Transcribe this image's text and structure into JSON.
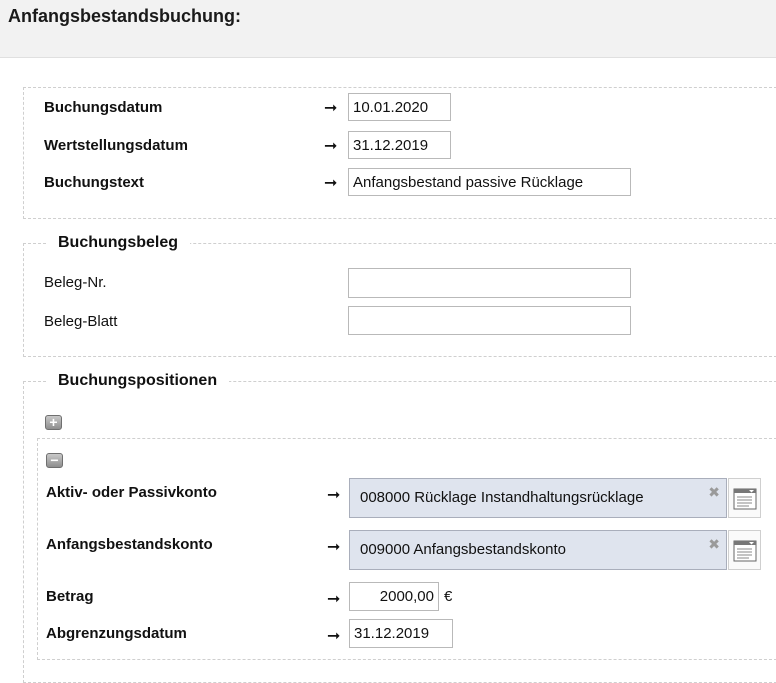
{
  "page": {
    "title": "Anfangsbestandsbuchung:"
  },
  "header_section": {
    "buchungsdatum": {
      "label": "Buchungsdatum",
      "value": "10.01.2020"
    },
    "wertstellungsdatum": {
      "label": "Wertstellungsdatum",
      "value": "31.12.2019"
    },
    "buchungstext": {
      "label": "Buchungstext",
      "value": "Anfangsbestand passive Rücklage"
    }
  },
  "beleg_section": {
    "legend": "Buchungsbeleg",
    "beleg_nr": {
      "label": "Beleg-Nr.",
      "value": ""
    },
    "beleg_blatt": {
      "label": "Beleg-Blatt",
      "value": ""
    }
  },
  "positions_section": {
    "legend": "Buchungspositionen",
    "add_glyph": "+",
    "remove_glyph": "−",
    "aktiv_passiv": {
      "label": "Aktiv- oder Passivkonto",
      "value": "008000 Rücklage Instandhaltungsrücklage"
    },
    "anfangsbestand": {
      "label": "Anfangsbestandskonto",
      "value": "009000 Anfangsbestandskonto"
    },
    "betrag": {
      "label": "Betrag",
      "value": "2000,00",
      "currency": "€"
    },
    "abgrenzungsdatum": {
      "label": "Abgrenzungsdatum",
      "value": "31.12.2019"
    }
  },
  "glyphs": {
    "arrow": "➞",
    "clear": "✖"
  },
  "icons": {
    "required_arrow": "arrow-right-icon",
    "clear": "clear-icon",
    "picker": "list-picker-icon"
  }
}
